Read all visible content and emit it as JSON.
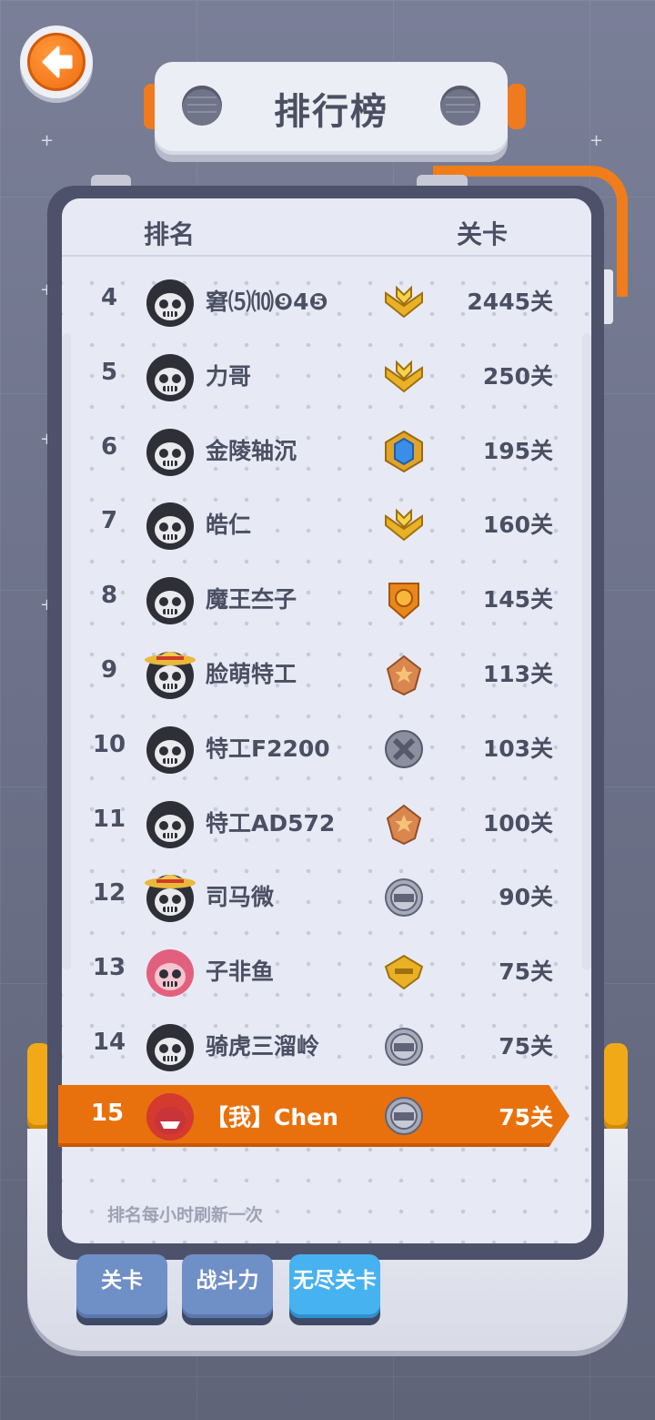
{
  "title": "排行榜",
  "header": {
    "rank_label": "排名",
    "level_label": "关卡"
  },
  "rows": [
    {
      "rank": "4",
      "name": "窘⑸⑽❾4❺",
      "avatar": "skull-hood",
      "badge": "gold-wings",
      "score": "2445关"
    },
    {
      "rank": "5",
      "name": "力哥",
      "avatar": "skull-hood",
      "badge": "gold-wings",
      "score": "250关"
    },
    {
      "rank": "6",
      "name": "金陵轴沉",
      "avatar": "skull-hood",
      "badge": "blue-gem",
      "score": "195关"
    },
    {
      "rank": "7",
      "name": "皓仁",
      "avatar": "skull-hood",
      "badge": "gold-wings",
      "score": "160关"
    },
    {
      "rank": "8",
      "name": "魔王夳子",
      "avatar": "skull-hood",
      "badge": "orange-shield",
      "score": "145关"
    },
    {
      "rank": "9",
      "name": "脸萌特工",
      "avatar": "straw-hat",
      "badge": "bronze-star",
      "score": "113关"
    },
    {
      "rank": "10",
      "name": "特工F2200",
      "avatar": "skull-hood",
      "badge": "gray-x",
      "score": "103关"
    },
    {
      "rank": "11",
      "name": "特工AD572",
      "avatar": "skull-hood",
      "badge": "bronze-star",
      "score": "100关"
    },
    {
      "rank": "12",
      "name": "司马微",
      "avatar": "straw-hat",
      "badge": "silver-zb",
      "score": "90关"
    },
    {
      "rank": "13",
      "name": "子非鱼",
      "avatar": "pink-hood",
      "badge": "gold-wing-small",
      "score": "75关"
    },
    {
      "rank": "14",
      "name": "骑虎三溜岭",
      "avatar": "skull-hood",
      "badge": "silver-zb",
      "score": "75关"
    }
  ],
  "me": {
    "rank": "15",
    "name": "【我】Chen",
    "avatar": "red-hood",
    "badge": "silver-zb",
    "score": "75关"
  },
  "footer_note": "排名每小时刷新一次",
  "tabs": [
    {
      "label": "关卡",
      "active": false
    },
    {
      "label": "战斗力",
      "active": false
    },
    {
      "label": "无尽关卡",
      "active": true
    }
  ],
  "colors": {
    "accent_orange": "#e8710e",
    "panel_bg": "#e7eaf5",
    "text_dark": "#4b4f63",
    "tab_active": "#47b2f0",
    "tab_inactive": "#6f8fc7"
  }
}
